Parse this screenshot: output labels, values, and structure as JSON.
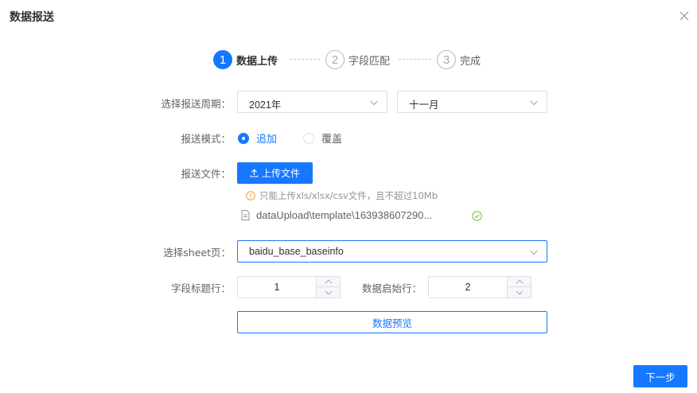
{
  "dialog": {
    "title": "数据报送"
  },
  "steps": [
    {
      "number": "1",
      "label": "数据上传",
      "active": true
    },
    {
      "number": "2",
      "label": "字段匹配",
      "active": false
    },
    {
      "number": "3",
      "label": "完成",
      "active": false
    }
  ],
  "period": {
    "label": "选择报送周期：",
    "year": "2021年",
    "month": "十一月"
  },
  "mode": {
    "label": "报送模式：",
    "options": [
      "追加",
      "覆盖"
    ],
    "selected": "追加"
  },
  "file": {
    "label": "报送文件：",
    "upload_label": "上传文件",
    "tip": "只能上传xls/xlsx/csv文件，且不超过10Mb",
    "uploaded_name": "dataUpload\\template\\163938607290..."
  },
  "sheet": {
    "label": "选择sheet页：",
    "value": "baidu_base_baseinfo"
  },
  "header_row": {
    "label": "字段标题行：",
    "value": "1"
  },
  "start_row": {
    "label": "数据启始行：",
    "value": "2"
  },
  "preview": {
    "label": "数据预览"
  },
  "footer": {
    "next_label": "下一步"
  },
  "colors": {
    "primary": "#1677ff",
    "success": "#67c23a",
    "warning": "#e6a23c",
    "border": "#dcdfe6"
  }
}
